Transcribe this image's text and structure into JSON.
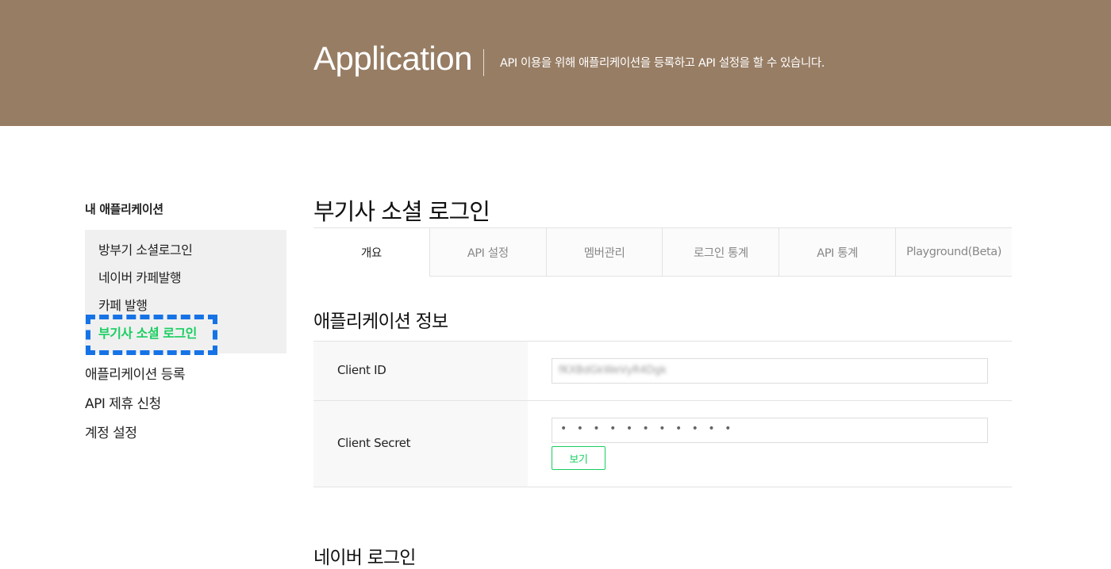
{
  "header": {
    "title": "Application",
    "description": "API 이용을 위해 애플리케이션을 등록하고 API 설정을 할 수 있습니다."
  },
  "sidebar": {
    "heading": "내 애플리케이션",
    "apps": [
      {
        "label": "방부기 소셜로그인",
        "active": false
      },
      {
        "label": "네이버 카페발행",
        "active": false
      },
      {
        "label": "카페 발행",
        "active": false
      },
      {
        "label": "부기사 소셜 로그인",
        "active": true
      }
    ],
    "links": [
      {
        "label": "애플리케이션 등록"
      },
      {
        "label": "API 제휴 신청"
      },
      {
        "label": "계정 설정"
      }
    ]
  },
  "main": {
    "title": "부기사 소셜 로그인",
    "tabs": [
      {
        "label": "개요",
        "selected": true
      },
      {
        "label": "API 설정",
        "selected": false
      },
      {
        "label": "멤버관리",
        "selected": false
      },
      {
        "label": "로그인 통계",
        "selected": false
      },
      {
        "label": "API 통계",
        "selected": false
      },
      {
        "label": "Playground(Beta)",
        "selected": false
      }
    ],
    "section_title": "애플리케이션 정보",
    "client_id": {
      "label": "Client ID",
      "value": "fKXBdGkWeVyR4Dgk"
    },
    "client_secret": {
      "label": "Client Secret",
      "value": "• • • • • • • • • • •",
      "show_button": "보기"
    },
    "next_section_title": "네이버 로그인"
  },
  "colors": {
    "header_bg": "#977d64",
    "accent_green": "#19ce60",
    "focus_blue": "#1673e6"
  }
}
